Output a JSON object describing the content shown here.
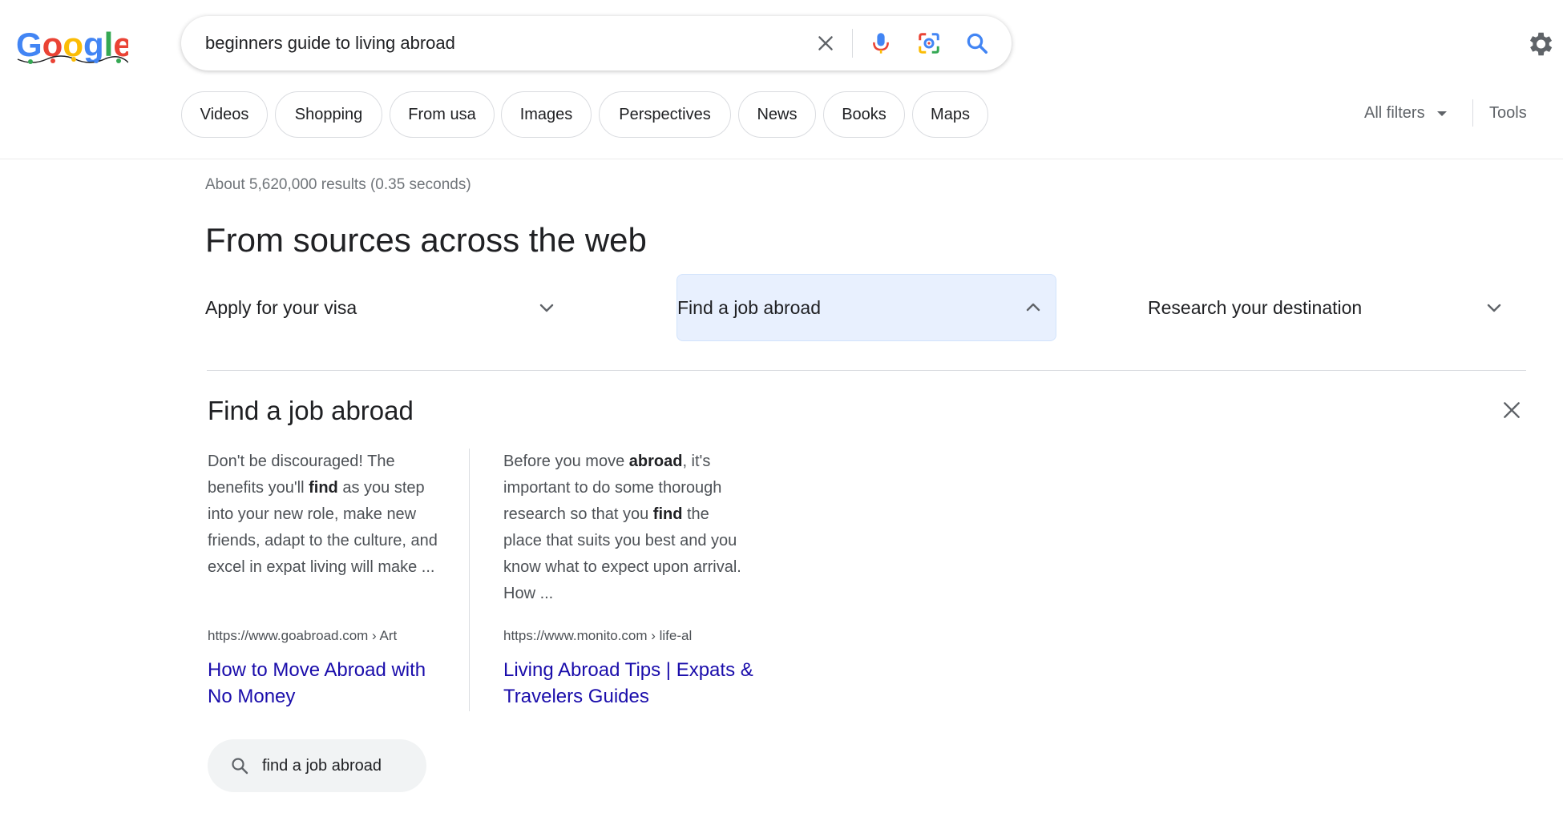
{
  "logo": {
    "alt": "Google"
  },
  "search": {
    "query": "beginners guide to living abroad"
  },
  "chips": [
    "Videos",
    "Shopping",
    "From usa",
    "Images",
    "Perspectives",
    "News",
    "Books",
    "Maps"
  ],
  "filters": {
    "all_filters": "All filters",
    "tools": "Tools"
  },
  "result_stats": "About 5,620,000 results (0.35 seconds)",
  "section_heading": "From sources across the web",
  "accordions": [
    {
      "label": "Apply for your visa",
      "expanded": false
    },
    {
      "label": "Find a job abroad",
      "expanded": true
    },
    {
      "label": "Research your destination",
      "expanded": false
    }
  ],
  "panel": {
    "title": "Find a job abroad",
    "results": [
      {
        "snippet_html": "Don't be discouraged! The benefits you'll <b>find</b> as you step into your new role, make new friends, adapt to the culture, and excel in expat living will make ...",
        "url": "https://www.goabroad.com › Art",
        "title": "How to Move Abroad with No Money"
      },
      {
        "snippet_html": "Before you move <b>abroad</b>, it's important to do some thorough research so that you <b>find</b> the place that suits you best and you know what to expect upon arrival. How ...",
        "url": "https://www.monito.com › life-al",
        "title": "Living Abroad Tips | Expats & Travelers Guides"
      }
    ],
    "related_search": "find a job abroad"
  },
  "icons": {
    "clear": "close-icon",
    "voice": "microphone-icon",
    "lens": "camera-lens-icon",
    "search": "search-icon",
    "settings": "gear-icon"
  },
  "colors": {
    "link": "#1a0dab",
    "selected_bg": "#e8f0fe",
    "google_blue": "#4285f4",
    "google_red": "#ea4335",
    "google_yellow": "#fbbc05",
    "google_green": "#34a853"
  }
}
